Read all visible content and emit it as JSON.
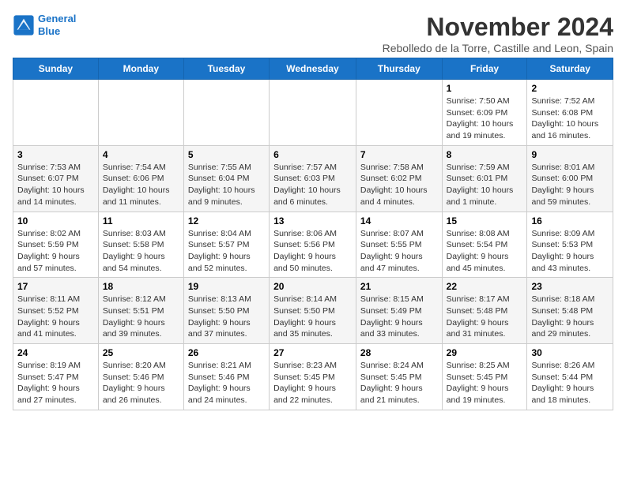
{
  "logo": {
    "line1": "General",
    "line2": "Blue"
  },
  "title": "November 2024",
  "subtitle": "Rebolledo de la Torre, Castille and Leon, Spain",
  "headers": [
    "Sunday",
    "Monday",
    "Tuesday",
    "Wednesday",
    "Thursday",
    "Friday",
    "Saturday"
  ],
  "weeks": [
    [
      {
        "day": "",
        "info": ""
      },
      {
        "day": "",
        "info": ""
      },
      {
        "day": "",
        "info": ""
      },
      {
        "day": "",
        "info": ""
      },
      {
        "day": "",
        "info": ""
      },
      {
        "day": "1",
        "info": "Sunrise: 7:50 AM\nSunset: 6:09 PM\nDaylight: 10 hours and 19 minutes."
      },
      {
        "day": "2",
        "info": "Sunrise: 7:52 AM\nSunset: 6:08 PM\nDaylight: 10 hours and 16 minutes."
      }
    ],
    [
      {
        "day": "3",
        "info": "Sunrise: 7:53 AM\nSunset: 6:07 PM\nDaylight: 10 hours and 14 minutes."
      },
      {
        "day": "4",
        "info": "Sunrise: 7:54 AM\nSunset: 6:06 PM\nDaylight: 10 hours and 11 minutes."
      },
      {
        "day": "5",
        "info": "Sunrise: 7:55 AM\nSunset: 6:04 PM\nDaylight: 10 hours and 9 minutes."
      },
      {
        "day": "6",
        "info": "Sunrise: 7:57 AM\nSunset: 6:03 PM\nDaylight: 10 hours and 6 minutes."
      },
      {
        "day": "7",
        "info": "Sunrise: 7:58 AM\nSunset: 6:02 PM\nDaylight: 10 hours and 4 minutes."
      },
      {
        "day": "8",
        "info": "Sunrise: 7:59 AM\nSunset: 6:01 PM\nDaylight: 10 hours and 1 minute."
      },
      {
        "day": "9",
        "info": "Sunrise: 8:01 AM\nSunset: 6:00 PM\nDaylight: 9 hours and 59 minutes."
      }
    ],
    [
      {
        "day": "10",
        "info": "Sunrise: 8:02 AM\nSunset: 5:59 PM\nDaylight: 9 hours and 57 minutes."
      },
      {
        "day": "11",
        "info": "Sunrise: 8:03 AM\nSunset: 5:58 PM\nDaylight: 9 hours and 54 minutes."
      },
      {
        "day": "12",
        "info": "Sunrise: 8:04 AM\nSunset: 5:57 PM\nDaylight: 9 hours and 52 minutes."
      },
      {
        "day": "13",
        "info": "Sunrise: 8:06 AM\nSunset: 5:56 PM\nDaylight: 9 hours and 50 minutes."
      },
      {
        "day": "14",
        "info": "Sunrise: 8:07 AM\nSunset: 5:55 PM\nDaylight: 9 hours and 47 minutes."
      },
      {
        "day": "15",
        "info": "Sunrise: 8:08 AM\nSunset: 5:54 PM\nDaylight: 9 hours and 45 minutes."
      },
      {
        "day": "16",
        "info": "Sunrise: 8:09 AM\nSunset: 5:53 PM\nDaylight: 9 hours and 43 minutes."
      }
    ],
    [
      {
        "day": "17",
        "info": "Sunrise: 8:11 AM\nSunset: 5:52 PM\nDaylight: 9 hours and 41 minutes."
      },
      {
        "day": "18",
        "info": "Sunrise: 8:12 AM\nSunset: 5:51 PM\nDaylight: 9 hours and 39 minutes."
      },
      {
        "day": "19",
        "info": "Sunrise: 8:13 AM\nSunset: 5:50 PM\nDaylight: 9 hours and 37 minutes."
      },
      {
        "day": "20",
        "info": "Sunrise: 8:14 AM\nSunset: 5:50 PM\nDaylight: 9 hours and 35 minutes."
      },
      {
        "day": "21",
        "info": "Sunrise: 8:15 AM\nSunset: 5:49 PM\nDaylight: 9 hours and 33 minutes."
      },
      {
        "day": "22",
        "info": "Sunrise: 8:17 AM\nSunset: 5:48 PM\nDaylight: 9 hours and 31 minutes."
      },
      {
        "day": "23",
        "info": "Sunrise: 8:18 AM\nSunset: 5:48 PM\nDaylight: 9 hours and 29 minutes."
      }
    ],
    [
      {
        "day": "24",
        "info": "Sunrise: 8:19 AM\nSunset: 5:47 PM\nDaylight: 9 hours and 27 minutes."
      },
      {
        "day": "25",
        "info": "Sunrise: 8:20 AM\nSunset: 5:46 PM\nDaylight: 9 hours and 26 minutes."
      },
      {
        "day": "26",
        "info": "Sunrise: 8:21 AM\nSunset: 5:46 PM\nDaylight: 9 hours and 24 minutes."
      },
      {
        "day": "27",
        "info": "Sunrise: 8:23 AM\nSunset: 5:45 PM\nDaylight: 9 hours and 22 minutes."
      },
      {
        "day": "28",
        "info": "Sunrise: 8:24 AM\nSunset: 5:45 PM\nDaylight: 9 hours and 21 minutes."
      },
      {
        "day": "29",
        "info": "Sunrise: 8:25 AM\nSunset: 5:45 PM\nDaylight: 9 hours and 19 minutes."
      },
      {
        "day": "30",
        "info": "Sunrise: 8:26 AM\nSunset: 5:44 PM\nDaylight: 9 hours and 18 minutes."
      }
    ]
  ]
}
